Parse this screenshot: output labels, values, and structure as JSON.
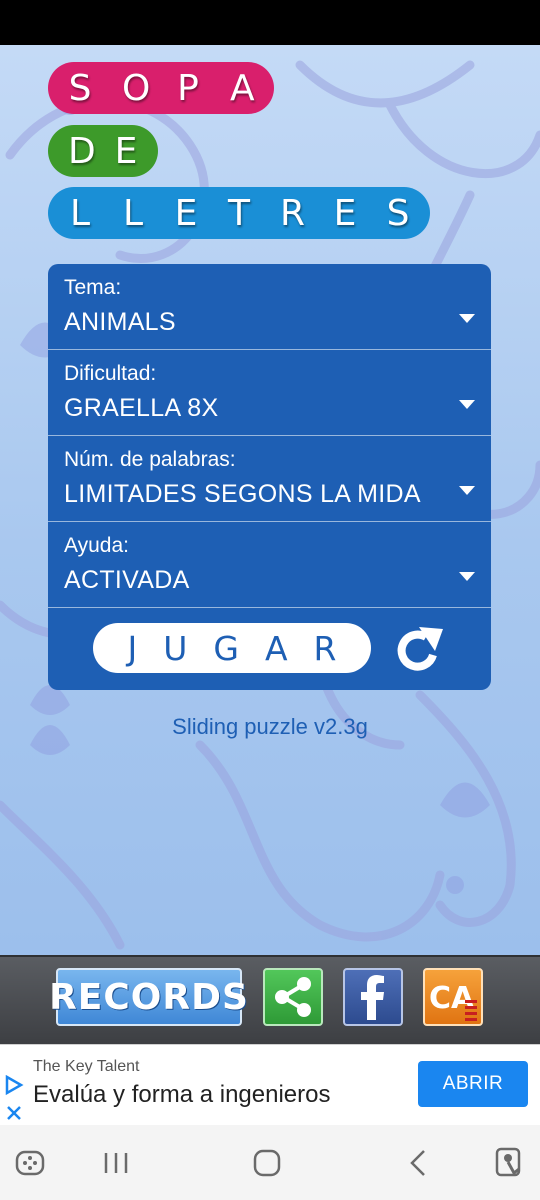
{
  "title": {
    "line1": [
      "S",
      "O",
      "P",
      "A"
    ],
    "line2": [
      "D",
      "E"
    ],
    "line3": [
      "L",
      "L",
      "E",
      "T",
      "R",
      "E",
      "S"
    ]
  },
  "options": [
    {
      "label": "Tema:",
      "value": "ANIMALS"
    },
    {
      "label": "Dificultad:",
      "value": "GRAELLA 8X"
    },
    {
      "label": "Núm. de palabras:",
      "value": "LIMITADES SEGONS LA MIDA"
    },
    {
      "label": "Ayuda:",
      "value": "ACTIVADA"
    }
  ],
  "play_label": "JUGAR",
  "version": "Sliding puzzle v2.3g",
  "bottombar": {
    "records_label": "RECORDS",
    "ca_label": "CA"
  },
  "ad": {
    "source": "The Key Talent",
    "headline": "Evalúa y forma a ingenieros",
    "cta": "ABRIR"
  },
  "colors": {
    "pill_pink": "#d91f6c",
    "pill_green": "#3d9a2a",
    "pill_blue": "#1a8fd6",
    "panel_blue": "#1e5fb4",
    "ad_cta": "#1a86f0"
  },
  "icons": [
    "refresh-icon",
    "share-icon",
    "facebook-icon",
    "ad-choices-icon",
    "assistant-icon",
    "recents-icon",
    "home-icon",
    "back-icon",
    "accessibility-icon"
  ]
}
